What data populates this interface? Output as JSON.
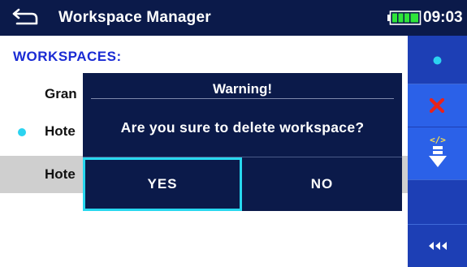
{
  "titlebar": {
    "back_icon": "back-arrow-icon",
    "title": "Workspace Manager",
    "battery_icon": "battery-full-icon",
    "time": "09:03"
  },
  "workspaces": {
    "header": "WORKSPACES:",
    "items": [
      {
        "label": "Gran",
        "active": false,
        "selected": false
      },
      {
        "label": "Hote",
        "active": true,
        "selected": false
      },
      {
        "label": "Hote",
        "active": false,
        "selected": true
      }
    ]
  },
  "sidebar": {
    "buttons": [
      {
        "icon": "open-workspace-dot-icon",
        "active": false
      },
      {
        "icon": "delete-x-icon",
        "active": true
      },
      {
        "icon": "export-download-icon",
        "active": false
      },
      {
        "icon": "empty-slot",
        "active": false
      },
      {
        "icon": "back-triangles-icon",
        "active": false
      }
    ]
  },
  "dialog": {
    "title": "Warning!",
    "message": "Are you sure to delete workspace?",
    "yes_label": "YES",
    "no_label": "NO",
    "focused_button": "YES"
  },
  "colors": {
    "header_bg": "#0b1a4a",
    "sidebar_bg": "#1d3fb5",
    "sidebar_active_bg": "#2b61e8",
    "accent_cyan": "#27d8ef",
    "list_header_text": "#1a2bd4",
    "selected_row_bg": "#cfcfcf",
    "delete_red": "#e8221b"
  }
}
